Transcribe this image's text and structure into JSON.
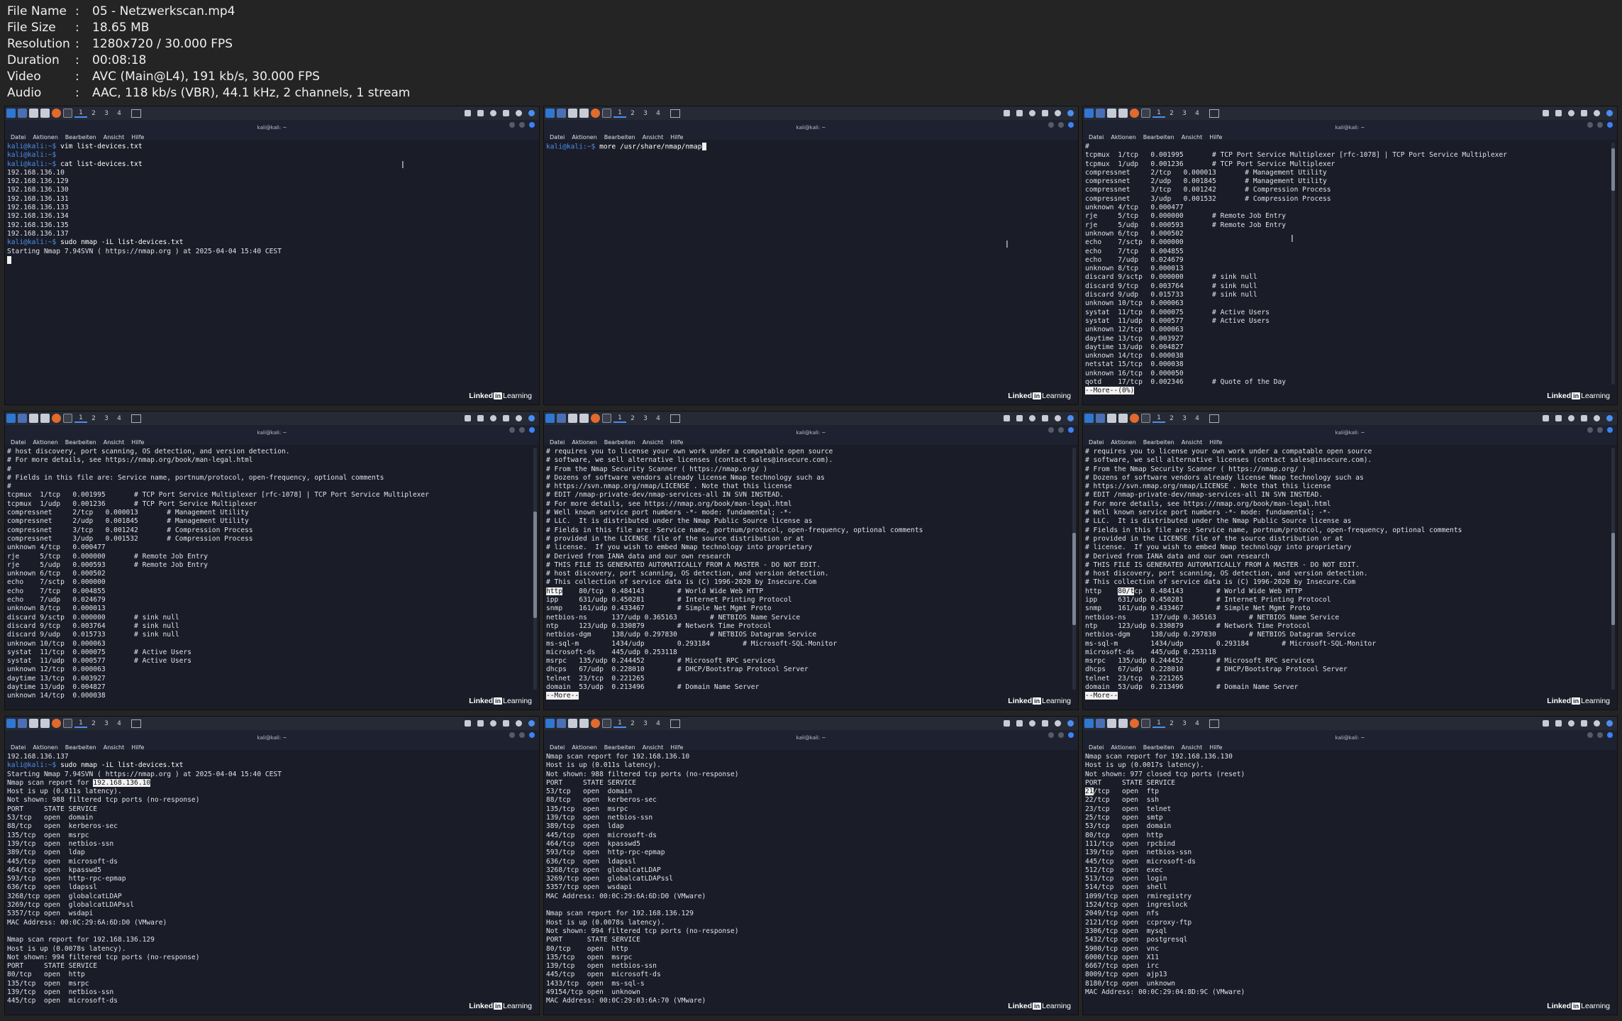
{
  "info": [
    {
      "key": "File Name",
      "value": "05 - Netzwerkscan.mp4"
    },
    {
      "key": "File Size",
      "value": "18.65 MB"
    },
    {
      "key": "Resolution",
      "value": "1280x720 / 30.000 FPS"
    },
    {
      "key": "Duration",
      "value": "00:08:18"
    },
    {
      "key": "Video",
      "value": "AVC (Main@L4), 191 kb/s, 30.000 FPS"
    },
    {
      "key": "Audio",
      "value": "AAC, 118 kb/s (VBR), 44.1 kHz, 2 channels, 1 stream"
    }
  ],
  "info_separator": ":",
  "taskbar": {
    "workspaces": [
      "1",
      "2",
      "3",
      "4"
    ]
  },
  "window_title": "kali@kali: ~",
  "menu": [
    "Datei",
    "Aktionen",
    "Bearbeiten",
    "Ansicht",
    "Hilfe"
  ],
  "watermark": {
    "brand": "Linked",
    "box": "in",
    "suffix": "Learning"
  },
  "colors": {
    "terminal_bg": "#1a1d27",
    "prompt": "#4c8ef0",
    "accent": "#2f77d0"
  },
  "tiles": [
    {
      "lines": [
        "<p>kali@kali:~$ </p><c>vim list-devices.txt</c>",
        "<p>kali@kali:~$ </p>",
        "<p>kali@kali:~$ </p><c>cat list-devices.txt</c>",
        "192.168.136.10",
        "192.168.136.129",
        "192.168.136.130",
        "192.168.136.131",
        "192.168.136.133",
        "192.168.136.134",
        "192.168.136.135",
        "192.168.136.137",
        "<p>kali@kali:~$ </p><c>sudo nmap -iL list-devices.txt</c>",
        "Starting Nmap 7.94SVN ( https://nmap.org ) at 2025-04-04 15:40 CEST",
        "<cur>"
      ]
    },
    {
      "lines": [
        "<p>kali@kali:~$ </p><c>more /usr/share/nmap/nmap</c><cur>"
      ]
    },
    {
      "lines": [
        "#",
        "tcpmux  1/tcp   0.001995       # TCP Port Service Multiplexer [rfc-1078] | TCP Port Service Multiplexer",
        "tcpmux  1/udp   0.001236       # TCP Port Service Multiplexer",
        "compressnet     2/tcp   0.000013       # Management Utility",
        "compressnet     2/udp   0.001845       # Management Utility",
        "compressnet     3/tcp   0.001242       # Compression Process",
        "compressnet     3/udp   0.001532       # Compression Process",
        "unknown 4/tcp   0.000477",
        "rje     5/tcp   0.000000       # Remote Job Entry",
        "rje     5/udp   0.000593       # Remote Job Entry",
        "unknown 6/tcp   0.000502",
        "echo    7/sctp  0.000000",
        "echo    7/tcp   0.004855",
        "echo    7/udp   0.024679",
        "unknown 8/tcp   0.000013",
        "discard 9/sctp  0.000000       # sink null",
        "discard 9/tcp   0.003764       # sink null",
        "discard 9/udp   0.015733       # sink null",
        "unknown 10/tcp  0.000063",
        "systat  11/tcp  0.000075       # Active Users",
        "systat  11/udp  0.000577       # Active Users",
        "unknown 12/tcp  0.000063",
        "daytime 13/tcp  0.003927",
        "daytime 13/udp  0.004827",
        "unknown 14/tcp  0.000038",
        "netstat 15/tcp  0.000038",
        "unknown 16/tcp  0.000050",
        "qotd    17/tcp  0.002346       # Quote of the Day",
        "<h>--More--(0%)</h>"
      ]
    },
    {
      "lines": [
        "# host discovery, port scanning, OS detection, and version detection.",
        "# For more details, see https://nmap.org/book/man-legal.html",
        "#",
        "# Fields in this file are: Service name, portnum/protocol, open-frequency, optional comments",
        "#",
        "tcpmux  1/tcp   0.001995       # TCP Port Service Multiplexer [rfc-1078] | TCP Port Service Multiplexer",
        "tcpmux  1/udp   0.001236       # TCP Port Service Multiplexer",
        "compressnet     2/tcp   0.000013       # Management Utility",
        "compressnet     2/udp   0.001845       # Management Utility",
        "compressnet     3/tcp   0.001242       # Compression Process",
        "compressnet     3/udp   0.001532       # Compression Process",
        "unknown 4/tcp   0.000477",
        "rje     5/tcp   0.000000       # Remote Job Entry",
        "rje     5/udp   0.000593       # Remote Job Entry",
        "unknown 6/tcp   0.000502",
        "echo    7/sctp  0.000000",
        "echo    7/tcp   0.004855",
        "echo    7/udp   0.024679",
        "unknown 8/tcp   0.000013",
        "discard 9/sctp  0.000000       # sink null",
        "discard 9/tcp   0.003764       # sink null",
        "discard 9/udp   0.015733       # sink null",
        "unknown 10/tcp  0.000063",
        "systat  11/tcp  0.000075       # Active Users",
        "systat  11/udp  0.000577       # Active Users",
        "unknown 12/tcp  0.000063",
        "daytime 13/tcp  0.003927",
        "daytime 13/udp  0.004827",
        "unknown 14/tcp  0.000038"
      ]
    },
    {
      "lines": [
        "# requires you to license your own work under a compatable open source",
        "# software, we sell alternative licenses (contact sales@insecure.com).",
        "# From the Nmap Security Scanner ( https://nmap.org/ )",
        "# Dozens of software vendors already license Nmap technology such as",
        "# https://svn.nmap.org/nmap/LICENSE . Note that this license",
        "# EDIT /nmap-private-dev/nmap-services-all IN SVN INSTEAD.",
        "# For more details, see https://nmap.org/book/man-legal.html",
        "# Well known service port numbers -*- mode: fundamental; -*-",
        "# LLC.  It is distributed under the Nmap Public Source license as",
        "# Fields in this file are: Service name, portnum/protocol, open-frequency, optional comments",
        "# provided in the LICENSE file of the source distribution or at",
        "# license.  If you wish to embed Nmap technology into proprietary",
        "# Derived from IANA data and our own research",
        "# THIS FILE IS GENERATED AUTOMATICALLY FROM A MASTER - DO NOT EDIT.",
        "# host discovery, port scanning, OS detection, and version detection.",
        "# This collection of service data is (C) 1996-2020 by Insecure.Com",
        "<h>http</h>    80/tcp  0.484143        # World Wide Web HTTP",
        "ipp     631/udp 0.450281        # Internet Printing Protocol",
        "snmp    161/udp 0.433467        # Simple Net Mgmt Proto",
        "netbios-ns      137/udp 0.365163        # NETBIOS Name Service",
        "ntp     123/udp 0.330879        # Network Time Protocol",
        "netbios-dgm     138/udp 0.297830        # NETBIOS Datagram Service",
        "ms-sql-m        1434/udp        0.293184        # Microsoft-SQL-Monitor",
        "microsoft-ds    445/udp 0.253118",
        "msrpc   135/udp 0.244452        # Microsoft RPC services",
        "dhcps   67/udp  0.228010        # DHCP/Bootstrap Protocol Server",
        "telnet  23/tcp  0.221265",
        "domain  53/udp  0.213496        # Domain Name Server",
        "<h>--More--</h>"
      ]
    },
    {
      "lines": [
        "# requires you to license your own work under a compatable open source",
        "# software, we sell alternative licenses (contact sales@insecure.com).",
        "# From the Nmap Security Scanner ( https://nmap.org/ )",
        "# Dozens of software vendors already license Nmap technology such as",
        "# https://svn.nmap.org/nmap/LICENSE . Note that this license",
        "# EDIT /nmap-private-dev/nmap-services-all IN SVN INSTEAD.",
        "# For more details, see https://nmap.org/book/man-legal.html",
        "# Well known service port numbers -*- mode: fundamental; -*-",
        "# LLC.  It is distributed under the Nmap Public Source license as",
        "# Fields in this file are: Service name, portnum/protocol, open-frequency, optional comments",
        "# provided in the LICENSE file of the source distribution or at",
        "# license.  If you wish to embed Nmap technology into proprietary",
        "# Derived from IANA data and our own research",
        "# THIS FILE IS GENERATED AUTOMATICALLY FROM A MASTER - DO NOT EDIT.",
        "# host discovery, port scanning, OS detection, and version detection.",
        "# This collection of service data is (C) 1996-2020 by Insecure.Com",
        "http    <h>80/t</h>cp  0.484143        # World Wide Web HTTP",
        "ipp     631/udp 0.450281        # Internet Printing Protocol",
        "snmp    161/udp 0.433467        # Simple Net Mgmt Proto",
        "netbios-ns      137/udp 0.365163        # NETBIOS Name Service",
        "ntp     123/udp 0.330879        # Network Time Protocol",
        "netbios-dgm     138/udp 0.297830        # NETBIOS Datagram Service",
        "ms-sql-m        1434/udp        0.293184        # Microsoft-SQL-Monitor",
        "microsoft-ds    445/udp 0.253118",
        "msrpc   135/udp 0.244452        # Microsoft RPC services",
        "dhcps   67/udp  0.228010        # DHCP/Bootstrap Protocol Server",
        "telnet  23/tcp  0.221265",
        "domain  53/udp  0.213496        # Domain Name Server",
        "<h>--More--</h>"
      ]
    },
    {
      "lines": [
        "192.168.136.137",
        "<p>kali@kali:~$ </p><c>sudo nmap -iL list-devices.txt</c>",
        "Starting Nmap 7.94SVN ( https://nmap.org ) at 2025-04-04 15:40 CEST",
        "Nmap scan report for <h>192.168.136.10</h>",
        "Host is up (0.011s latency).",
        "Not shown: 988 filtered tcp ports (no-response)",
        "PORT     STATE SERVICE",
        "53/tcp   open  domain",
        "88/tcp   open  kerberos-sec",
        "135/tcp  open  msrpc",
        "139/tcp  open  netbios-ssn",
        "389/tcp  open  ldap",
        "445/tcp  open  microsoft-ds",
        "464/tcp  open  kpasswd5",
        "593/tcp  open  http-rpc-epmap",
        "636/tcp  open  ldapssl",
        "3268/tcp open  globalcatLDAP",
        "3269/tcp open  globalcatLDAPssl",
        "5357/tcp open  wsdapi",
        "MAC Address: 00:0C:29:6A:6D:D0 (VMware)",
        "",
        "Nmap scan report for 192.168.136.129",
        "Host is up (0.0078s latency).",
        "Not shown: 994 filtered tcp ports (no-response)",
        "PORT     STATE SERVICE",
        "80/tcp   open  http",
        "135/tcp  open  msrpc",
        "139/tcp  open  netbios-ssn",
        "445/tcp  open  microsoft-ds"
      ]
    },
    {
      "lines": [
        "Nmap scan report for 192.168.136.10",
        "Host is up (0.011s latency).",
        "Not shown: 988 filtered tcp ports (no-response)",
        "PORT     STATE SERVICE",
        "53/tcp   open  domain",
        "88/tcp   open  kerberos-sec",
        "135/tcp  open  msrpc",
        "139/tcp  open  netbios-ssn",
        "389/tcp  open  ldap",
        "445/tcp  open  microsoft-ds",
        "464/tcp  open  kpasswd5",
        "593/tcp  open  http-rpc-epmap",
        "636/tcp  open  ldapssl",
        "3268/tcp open  globalcatLDAP",
        "3269/tcp open  globalcatLDAPssl",
        "5357/tcp open  wsdapi",
        "MAC Address: 00:0C:29:6A:6D:D0 (VMware)",
        "",
        "Nmap scan report for 192.168.136.129",
        "Host is up (0.0078s latency).",
        "Not shown: 994 filtered tcp ports (no-response)",
        "PORT      STATE SERVICE",
        "80/tcp    open  http",
        "135/tcp   open  msrpc",
        "139/tcp   open  netbios-ssn",
        "445/tcp   open  microsoft-ds",
        "1433/tcp  open  ms-sql-s",
        "49154/tcp open  unknown",
        "MAC Address: 00:0C:29:03:6A:70 (VMware)"
      ]
    },
    {
      "lines": [
        "Nmap scan report for 192.168.136.130",
        "Host is up (0.0017s latency).",
        "Not shown: 977 closed tcp ports (reset)",
        "PORT     STATE SERVICE",
        "<h>21</h>/tcp   open  ftp",
        "22/tcp   open  ssh",
        "23/tcp   open  telnet",
        "25/tcp   open  smtp",
        "53/tcp   open  domain",
        "80/tcp   open  http",
        "111/tcp  open  rpcbind",
        "139/tcp  open  netbios-ssn",
        "445/tcp  open  microsoft-ds",
        "512/tcp  open  exec",
        "513/tcp  open  login",
        "514/tcp  open  shell",
        "1099/tcp open  rmiregistry",
        "1524/tcp open  ingreslock",
        "2049/tcp open  nfs",
        "2121/tcp open  ccproxy-ftp",
        "3306/tcp open  mysql",
        "5432/tcp open  postgresql",
        "5900/tcp open  vnc",
        "6000/tcp open  X11",
        "6667/tcp open  irc",
        "8009/tcp open  ajp13",
        "8180/tcp open  unknown",
        "MAC Address: 00:0C:29:04:8D:9C (VMware)"
      ]
    }
  ]
}
